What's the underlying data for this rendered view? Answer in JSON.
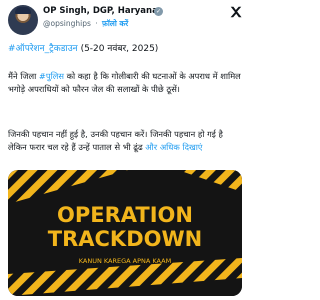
{
  "post": {
    "author_name": "OP Singh, DGP, Haryana",
    "handle": "@opsinghips",
    "separator": "·",
    "follow_label": "फ़ॉलो करें",
    "hashtag": "#ऑपरेशन_ट्रैकडाउन",
    "date_range": "(5-20 नवंबर, 2025)",
    "para1_pre": "मैंने जिला ",
    "para1_hashtag": "#पुलिस",
    "para1_post": " को कहा है कि गोलीबारी की घटनाओं के अपराध में शामिल भगोड़े अपराधियों को फौरन जेल की सलाखों के पीछे ठूसें।",
    "para2": "जिनकी पहचान नहीं हुई है, उनकी पहचान करें। जिनकी पहचान हो गई है लेकिन फरार चल रहे हैं उन्हें पाताल से भी ढूंढ",
    "show_more": "और अधिक दिखाएं"
  },
  "media": {
    "title_line1": "OPERATION",
    "title_line2": "TRACKDOWN",
    "tagline": "KANUN KAREGA APNA KAAM",
    "accent_color": "#f2b51c",
    "background_color": "#141414"
  },
  "icons": {
    "verified": "verified-badge-icon",
    "platform": "x-logo-icon"
  }
}
